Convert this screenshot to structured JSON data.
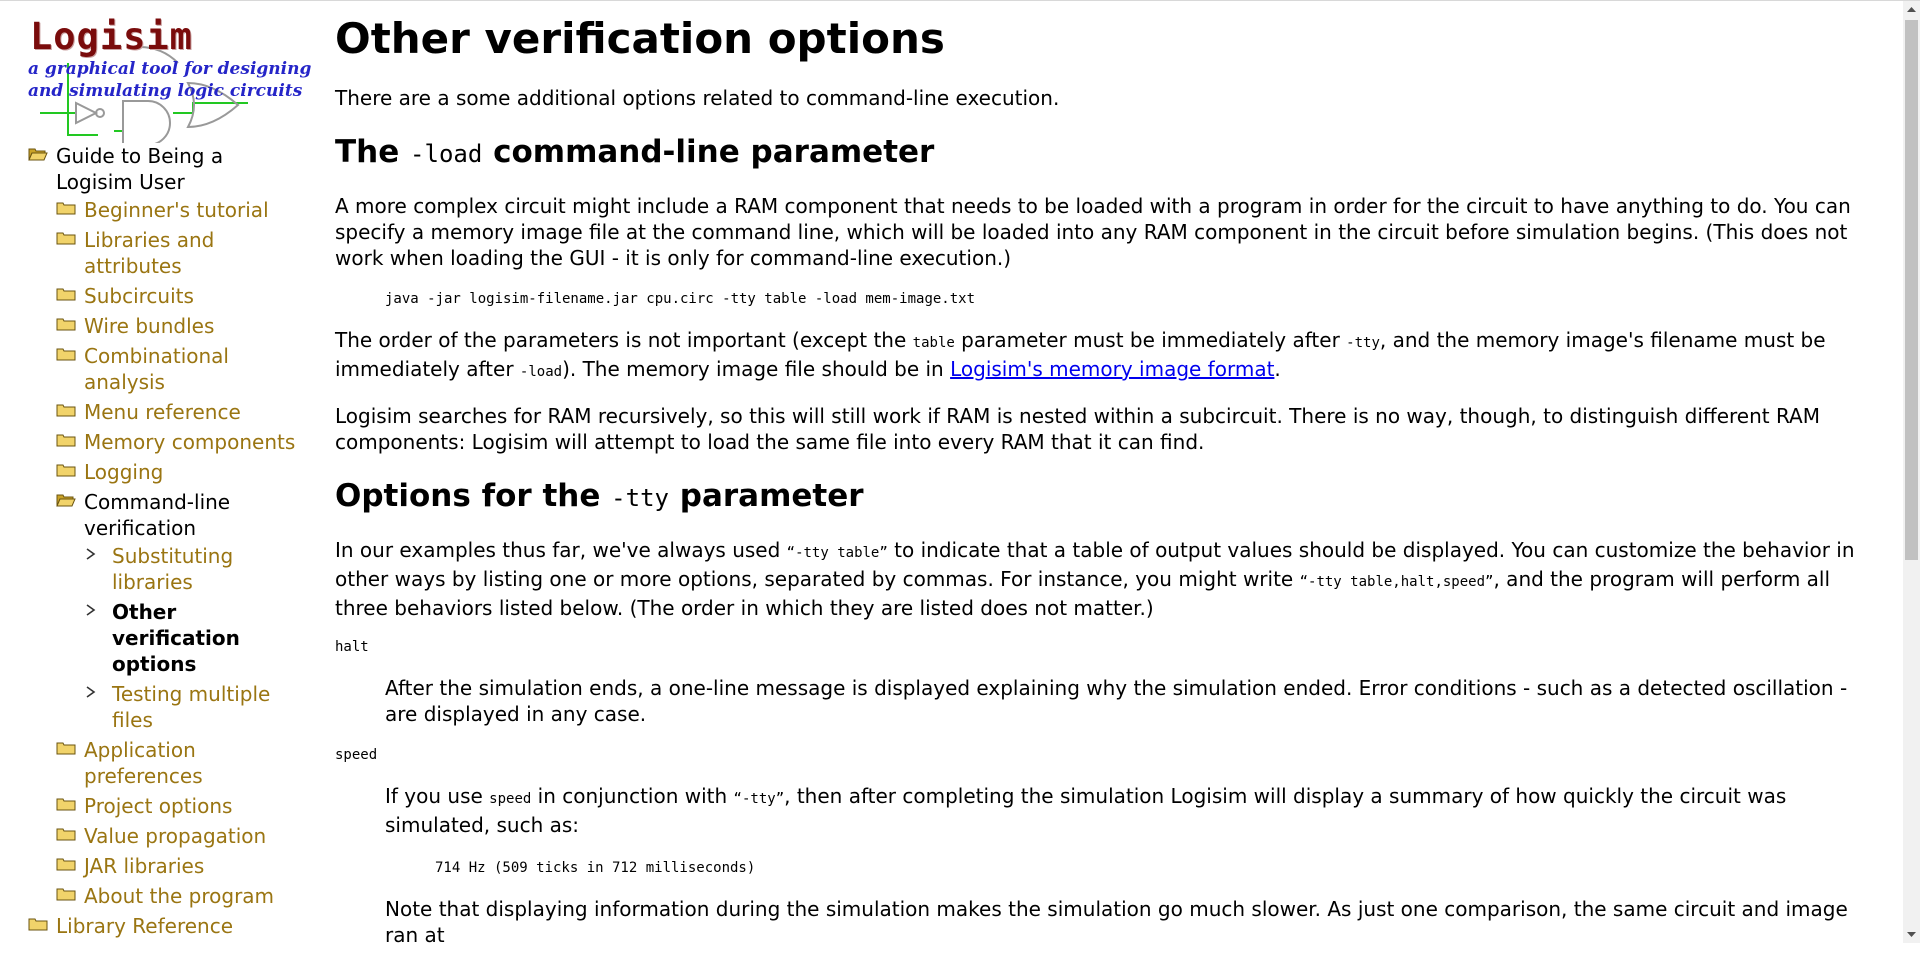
{
  "logo": {
    "title": "Logisim",
    "tagline_line1": "a graphical tool for designing",
    "tagline_line2": "and simulating logic circuits"
  },
  "nav": {
    "root_label": "Guide to Being a Logisim User",
    "items": [
      {
        "label": "Beginner's tutorial"
      },
      {
        "label": "Libraries and attributes"
      },
      {
        "label": "Subcircuits"
      },
      {
        "label": "Wire bundles"
      },
      {
        "label": "Combinational analysis"
      },
      {
        "label": "Menu reference"
      },
      {
        "label": "Memory components"
      },
      {
        "label": "Logging"
      },
      {
        "label": "Command-line verification"
      },
      {
        "label": "Application preferences"
      },
      {
        "label": "Project options"
      },
      {
        "label": "Value propagation"
      },
      {
        "label": "JAR libraries"
      },
      {
        "label": "About the program"
      }
    ],
    "subitems": [
      {
        "label": "Substituting libraries"
      },
      {
        "label": "Other verification options"
      },
      {
        "label": "Testing multiple files"
      }
    ],
    "library_reference": "Library Reference"
  },
  "content": {
    "title": "Other verification options",
    "intro": "There are a some additional options related to command-line execution.",
    "load_section": {
      "h_pre": "The ",
      "h_code": "-load",
      "h_post": " command-line parameter",
      "p1": "A more complex circuit might include a RAM component that needs to be loaded with a program in order for the circuit to have anything to do. You can specify a memory image file at the command line, which will be loaded into any RAM component in the circuit before simulation begins. (This does not work when loading the GUI - it is only for command-line execution.)",
      "command": "java -jar logisim-filename.jar cpu.circ -tty table -load mem-image.txt",
      "p2_a": "The order of the parameters is not important (except the ",
      "p2_code1": "table",
      "p2_b": " parameter must be immediately after ",
      "p2_code2": "-tty",
      "p2_c": ", and the memory image's filename must be immediately after ",
      "p2_code3": "-load",
      "p2_d": "). The memory image file should be in ",
      "p2_link": "Logisim's memory image format",
      "p2_e": ".",
      "p3": "Logisim searches for RAM recursively, so this will still work if RAM is nested within a subcircuit. There is no way, though, to distinguish different RAM components: Logisim will attempt to load the same file into every RAM that it can find."
    },
    "tty_section": {
      "h_pre": "Options for the ",
      "h_code": "-tty",
      "h_post": " parameter",
      "p_a": "In our examples thus far, we've always used ",
      "p_code1": "“-tty table”",
      "p_b": " to indicate that a table of output values should be displayed. You can customize the behavior in other ways by listing one or more options, separated by commas. For instance, you might write ",
      "p_code2": "“-tty table,halt,speed”",
      "p_c": ", and the program will perform all three behaviors listed below. (The order in which they are listed does not matter.)",
      "halt_term": "halt",
      "halt_desc": "After the simulation ends, a one-line message is displayed explaining why the simulation ended. Error conditions - such as a detected oscillation - are displayed in any case.",
      "speed_term": "speed",
      "speed_a": "If you use ",
      "speed_code1": "speed",
      "speed_b": " in conjunction with ",
      "speed_code2": "“-tty”",
      "speed_c": ", then after completing the simulation Logisim will display a summary of how quickly the circuit was simulated, such as:",
      "speed_example": "714 Hz (509 ticks in 712 milliseconds)",
      "speed_note": "Note that displaying information during the simulation makes the simulation go much slower. As just one comparison, the same circuit and image ran at"
    }
  }
}
